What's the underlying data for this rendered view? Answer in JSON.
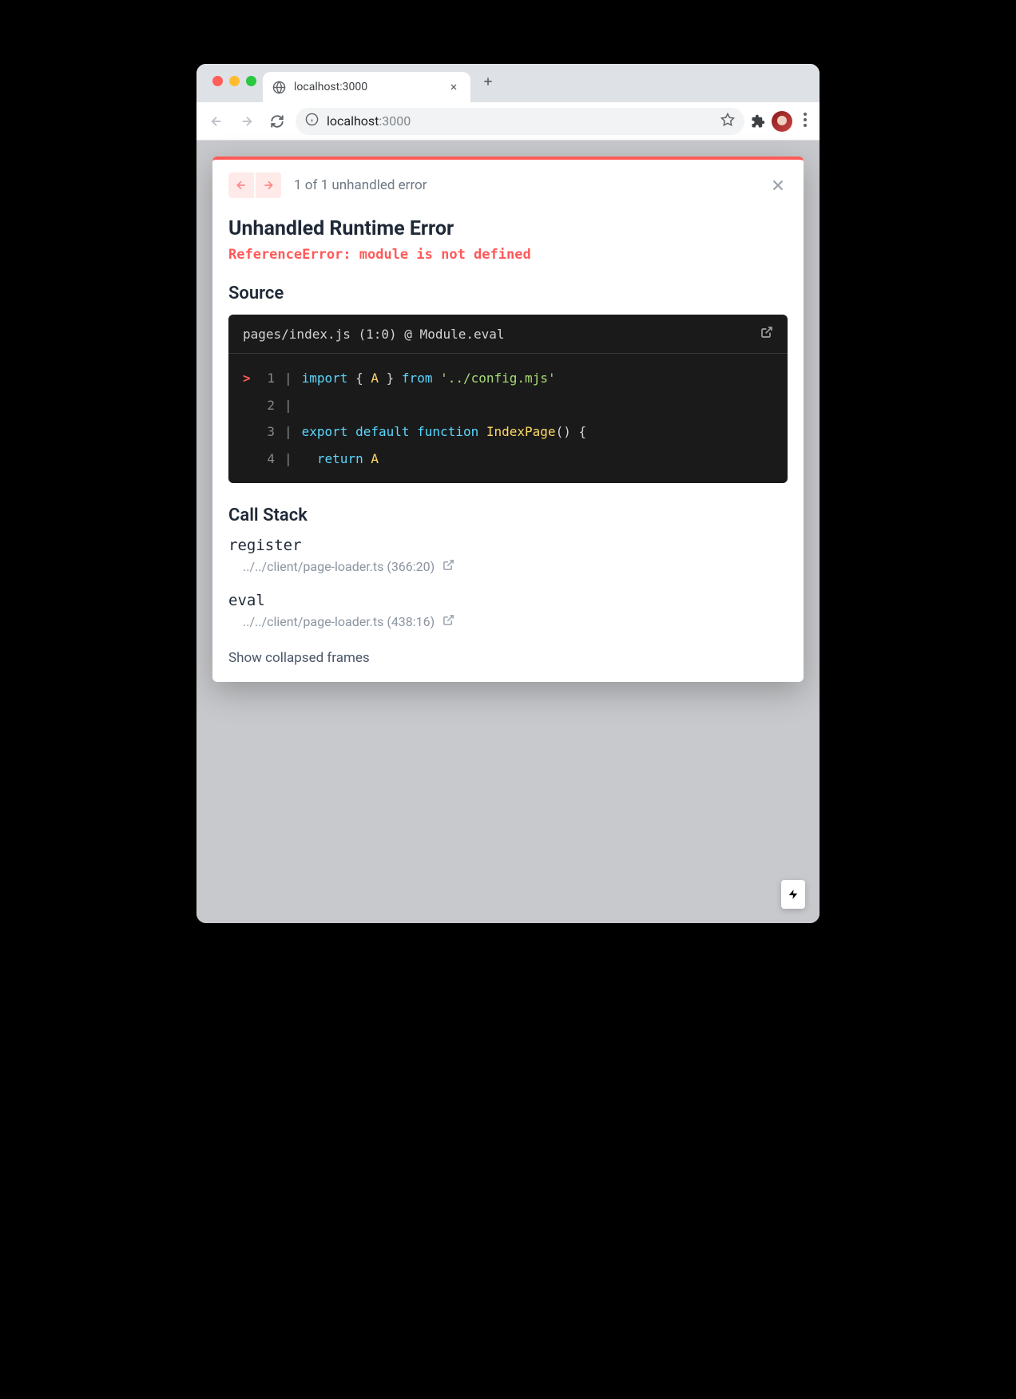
{
  "browser": {
    "tab_title": "localhost:3000",
    "url_host": "localhost",
    "url_port": ":3000"
  },
  "error_overlay": {
    "counter": "1 of 1 unhandled error",
    "title": "Unhandled Runtime Error",
    "message": "ReferenceError: module is not defined",
    "source_heading": "Source",
    "source_location": "pages/index.js (1:0) @ Module.eval",
    "code": {
      "lines": [
        {
          "marker": ">",
          "num": "1",
          "tokens": [
            {
              "t": "import",
              "c": "tok-kw"
            },
            {
              "t": " "
            },
            {
              "t": "{",
              "c": "tok-punc"
            },
            {
              "t": " "
            },
            {
              "t": "A",
              "c": "tok-id"
            },
            {
              "t": " "
            },
            {
              "t": "}",
              "c": "tok-punc"
            },
            {
              "t": " "
            },
            {
              "t": "from",
              "c": "tok-kw"
            },
            {
              "t": " "
            },
            {
              "t": "'../config.mjs'",
              "c": "tok-str"
            }
          ]
        },
        {
          "marker": " ",
          "num": "2",
          "tokens": []
        },
        {
          "marker": " ",
          "num": "3",
          "tokens": [
            {
              "t": "export",
              "c": "tok-kw"
            },
            {
              "t": " "
            },
            {
              "t": "default",
              "c": "tok-kw"
            },
            {
              "t": " "
            },
            {
              "t": "function",
              "c": "tok-kw"
            },
            {
              "t": " "
            },
            {
              "t": "IndexPage",
              "c": "tok-fn"
            },
            {
              "t": "()",
              "c": "tok-punc"
            },
            {
              "t": " "
            },
            {
              "t": "{",
              "c": "tok-punc"
            }
          ]
        },
        {
          "marker": " ",
          "num": "4",
          "tokens": [
            {
              "t": "  "
            },
            {
              "t": "return",
              "c": "tok-kw"
            },
            {
              "t": " "
            },
            {
              "t": "A",
              "c": "tok-id"
            }
          ]
        }
      ]
    },
    "callstack_heading": "Call Stack",
    "frames": [
      {
        "name": "register",
        "location": "../../client/page-loader.ts (366:20)"
      },
      {
        "name": "eval",
        "location": "../../client/page-loader.ts (438:16)"
      }
    ],
    "show_collapsed": "Show collapsed frames"
  }
}
